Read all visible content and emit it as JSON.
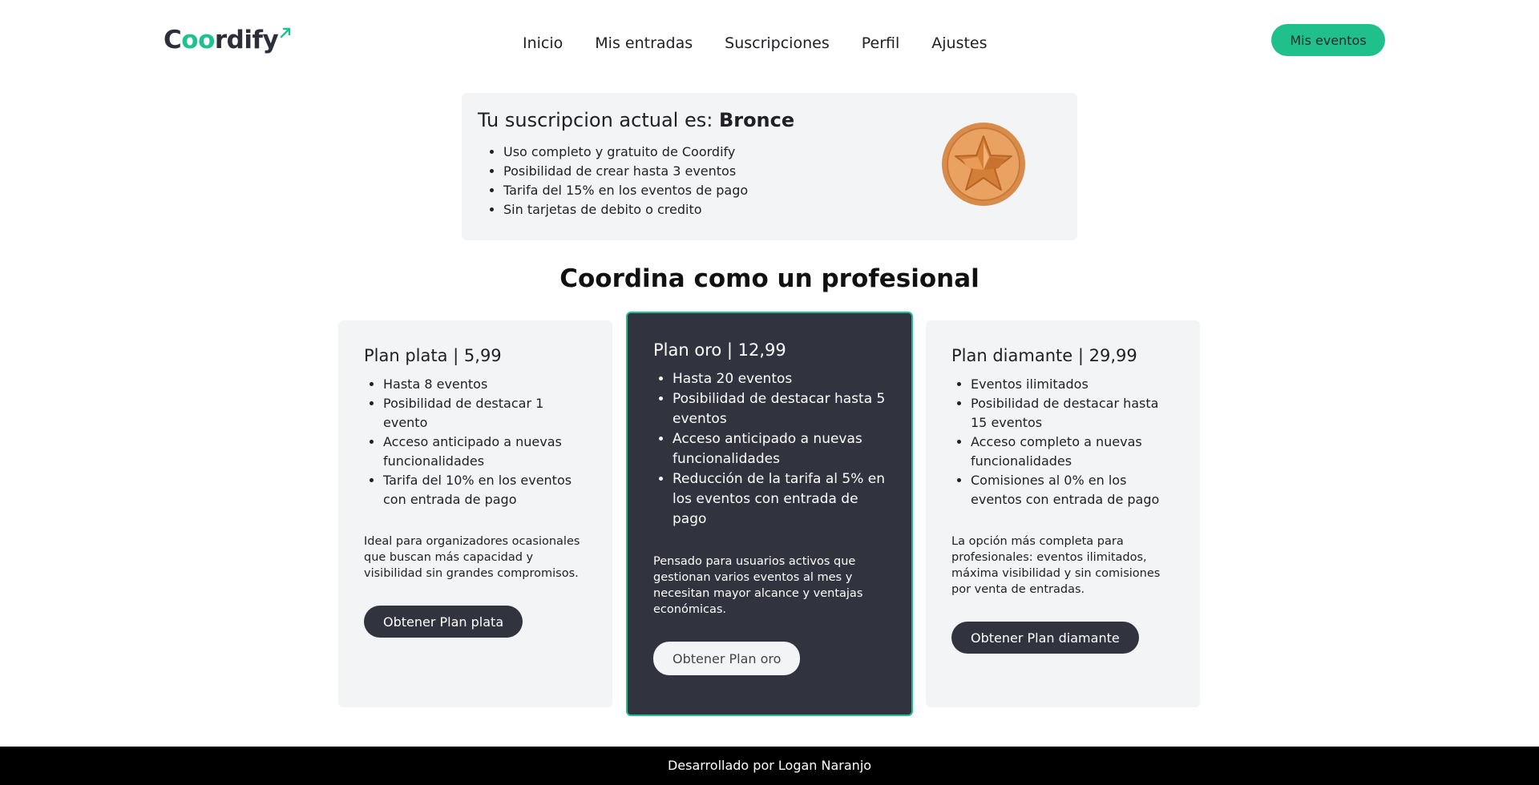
{
  "brand": {
    "logo_text_start": "C",
    "logo_text_accent": "oo",
    "logo_text_end": "rdify",
    "accent_color": "#1fc08c",
    "dark_color": "#31333f"
  },
  "nav": {
    "items": [
      "Inicio",
      "Mis entradas",
      "Suscripciones",
      "Perfil",
      "Ajustes"
    ]
  },
  "header": {
    "mis_eventos_label": "Mis eventos"
  },
  "current": {
    "prefix": "Tu suscripcion actual es: ",
    "plan_name": "Bronce",
    "features": [
      "Uso completo y gratuito de Coordify",
      "Posibilidad de crear hasta 3 eventos",
      "Tarifa del 15% en los eventos de pago",
      "Sin tarjetas de debito o credito"
    ],
    "medal_icon": "bronze-star-medal"
  },
  "section_title": "Coordina como un profesional",
  "plans": [
    {
      "title": "Plan plata | 5,99",
      "features": [
        "Hasta 8 eventos",
        "Posibilidad de destacar 1 evento",
        "Acceso anticipado a nuevas funcionalidades",
        "Tarifa del 10% en los eventos con entrada de pago"
      ],
      "description": "Ideal para organizadores ocasionales que buscan más capacidad y visibilidad sin grandes compromisos.",
      "button": "Obtener Plan plata"
    },
    {
      "title": "Plan oro | 12,99",
      "features": [
        "Hasta 20 eventos",
        "Posibilidad de destacar hasta 5 eventos",
        "Acceso anticipado a nuevas funcionalidades",
        "Reducción de la tarifa al 5% en los eventos con entrada de pago"
      ],
      "description": "Pensado para usuarios activos que gestionan varios eventos al mes y necesitan mayor alcance y ventajas económicas.",
      "button": "Obtener Plan oro"
    },
    {
      "title": "Plan diamante | 29,99",
      "features": [
        "Eventos ilimitados",
        "Posibilidad de destacar hasta 15 eventos",
        "Acceso completo a nuevas funcionalidades",
        "Comisiones al 0% en los eventos con entrada de pago"
      ],
      "description": "La opción más completa para profesionales: eventos ilimitados, máxima visibilidad y sin comisiones por venta de entradas.",
      "button": "Obtener Plan diamante"
    }
  ],
  "footer": {
    "text": "Desarrollado por Logan Naranjo"
  }
}
